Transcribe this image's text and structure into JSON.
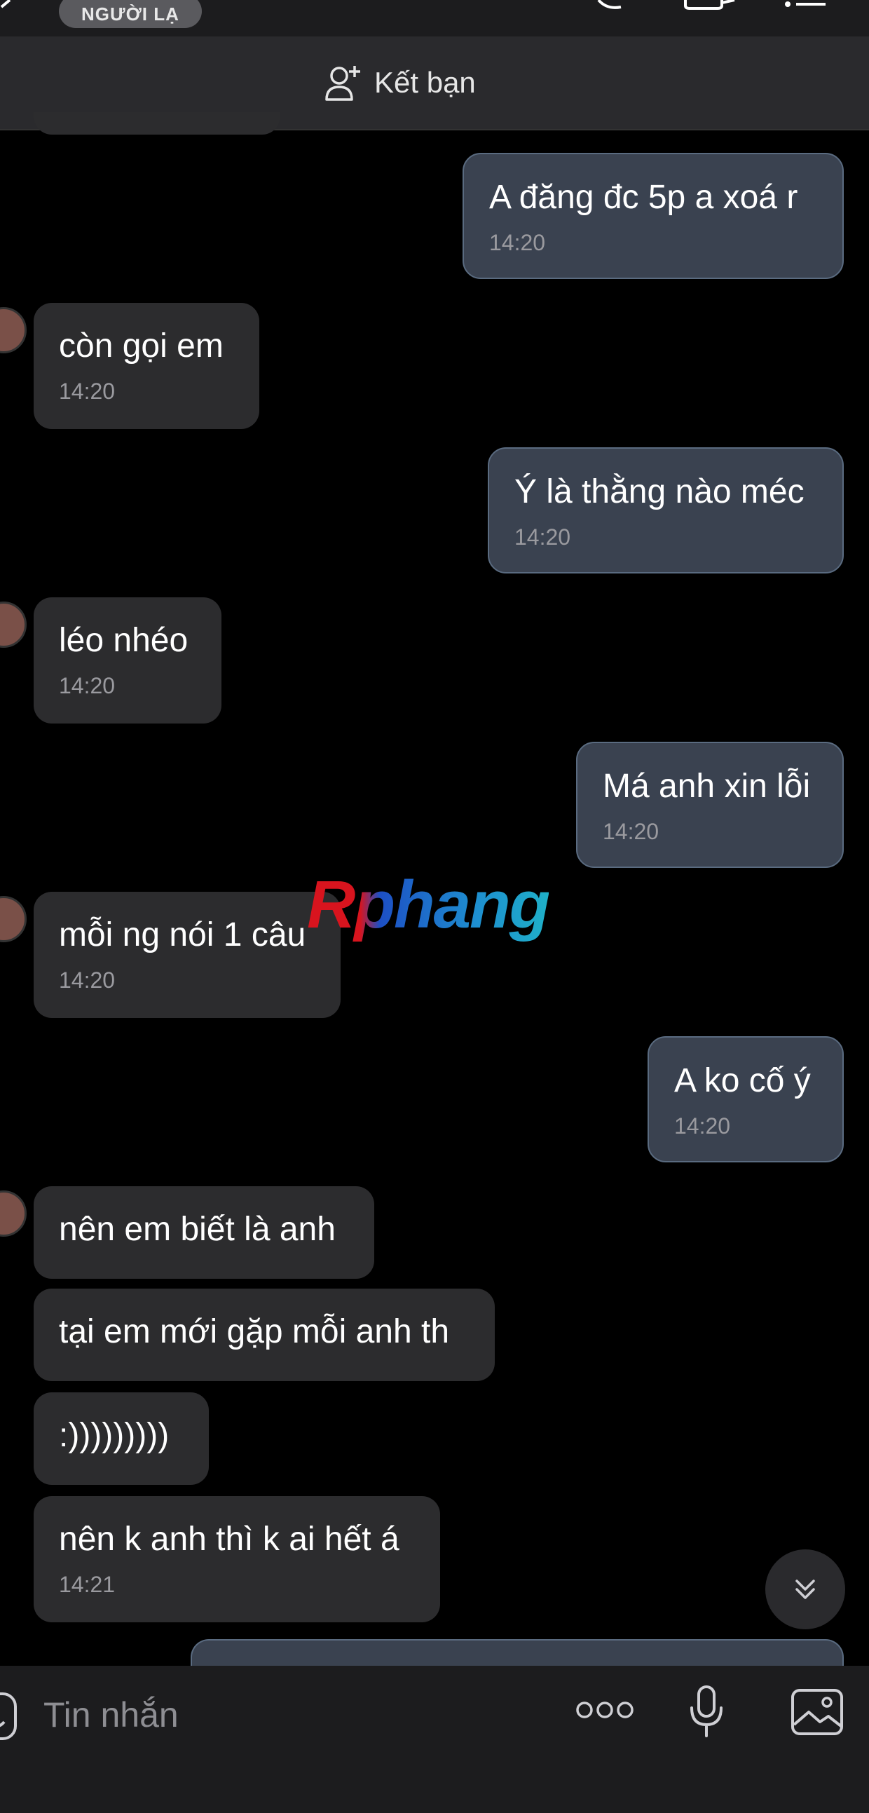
{
  "header": {
    "stranger_badge": "NGƯỜI LẠ"
  },
  "friend_bar": {
    "add_friend_label": "Kết bạn"
  },
  "messages": [
    {
      "side": "out",
      "text": "A đăng đc 5p a xoá r",
      "time": "14:20"
    },
    {
      "side": "in",
      "text": "còn gọi em",
      "time": "14:20"
    },
    {
      "side": "out",
      "text": "Ý là thằng nào méc",
      "time": "14:20"
    },
    {
      "side": "in",
      "text": "léo nhéo",
      "time": "14:20"
    },
    {
      "side": "out",
      "text": "Má anh xin lỗi",
      "time": "14:20"
    },
    {
      "side": "in",
      "text": "mỗi ng nói 1 câu",
      "time": "14:20"
    },
    {
      "side": "out",
      "text": "A ko cố ý",
      "time": "14:20"
    },
    {
      "side": "in",
      "text": "nên em biết là anh",
      "time": ""
    },
    {
      "side": "in",
      "text": "tại em mới gặp mỗi anh th",
      "time": ""
    },
    {
      "side": "in",
      "text": ":)))))))))",
      "time": ""
    },
    {
      "side": "in",
      "text": "nên k anh thì k ai hết á",
      "time": "14:21"
    }
  ],
  "watermark": "Rphang",
  "composer": {
    "placeholder": "Tin nhắn"
  },
  "icons": [
    "back-icon",
    "call-icon",
    "video-call-icon",
    "menu-icon",
    "add-friend-icon",
    "sticker-icon",
    "more-icon",
    "microphone-icon",
    "image-icon",
    "scroll-down-icon"
  ]
}
